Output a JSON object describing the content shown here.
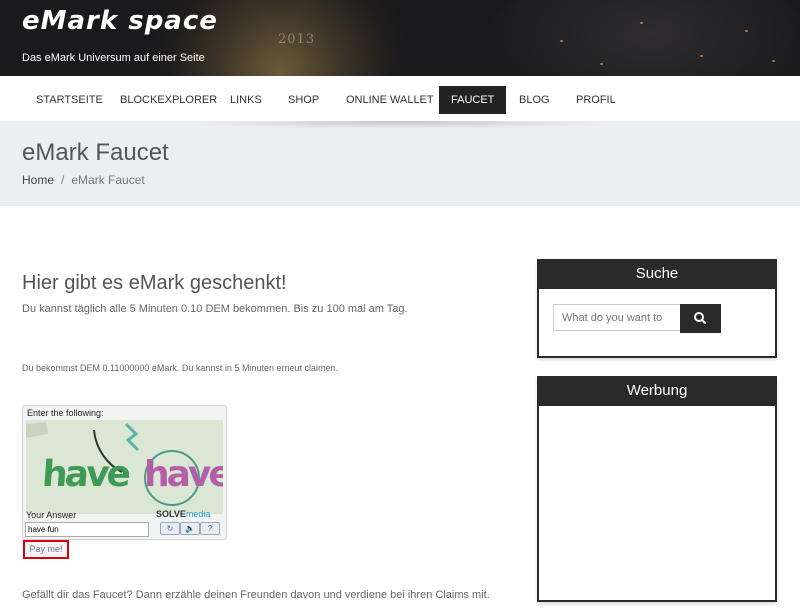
{
  "header": {
    "logo": "eMark space",
    "tagline": "Das eMark Universum auf einer Seite",
    "coin_year": "2013"
  },
  "nav": {
    "items": [
      {
        "label": "STARTSEITE"
      },
      {
        "label": "BLOCKEXPLORER"
      },
      {
        "label": "LINKS"
      },
      {
        "label": "SHOP"
      },
      {
        "label": "ONLINE WALLET"
      },
      {
        "label": "FAUCET",
        "active": true
      },
      {
        "label": "BLOG"
      },
      {
        "label": "PROFIL"
      }
    ]
  },
  "page": {
    "title": "eMark Faucet",
    "breadcrumb": {
      "home": "Home",
      "separator": "/",
      "current": "eMark Faucet"
    }
  },
  "main": {
    "heading": "Hier gibt es eMark geschenkt!",
    "subtitle": "Du kannst täglich alle 5 Minuten 0.10 DEM bekommen. Bis zu 100 mal am Tag.",
    "claim_info": "Du bekommst DEM 0.11000000 eMark. Du kannst in 5 Minuten erneut claimen.",
    "captcha": {
      "instruction": "Enter the following:",
      "challenge_text": "have fun",
      "answer_label": "Your Answer",
      "answer_value": "have fun",
      "brand": "SOLVE",
      "brand_suffix": "media",
      "buttons": [
        "↻",
        "🔈",
        "?"
      ]
    },
    "pay_button": "Pay me!",
    "share_text": "Gefällt dir das Faucet? Dann erzähle deinen Freunden davon und verdiene bei ihren Claims mit."
  },
  "sidebar": {
    "search": {
      "title": "Suche",
      "placeholder": "What do you want to"
    },
    "ads": {
      "title": "Werbung"
    }
  },
  "colors": {
    "nav_active": "#222222",
    "widget_header": "#2a2a2a",
    "pay_border": "#d9000d",
    "brand_media": "#2a9ad6"
  }
}
